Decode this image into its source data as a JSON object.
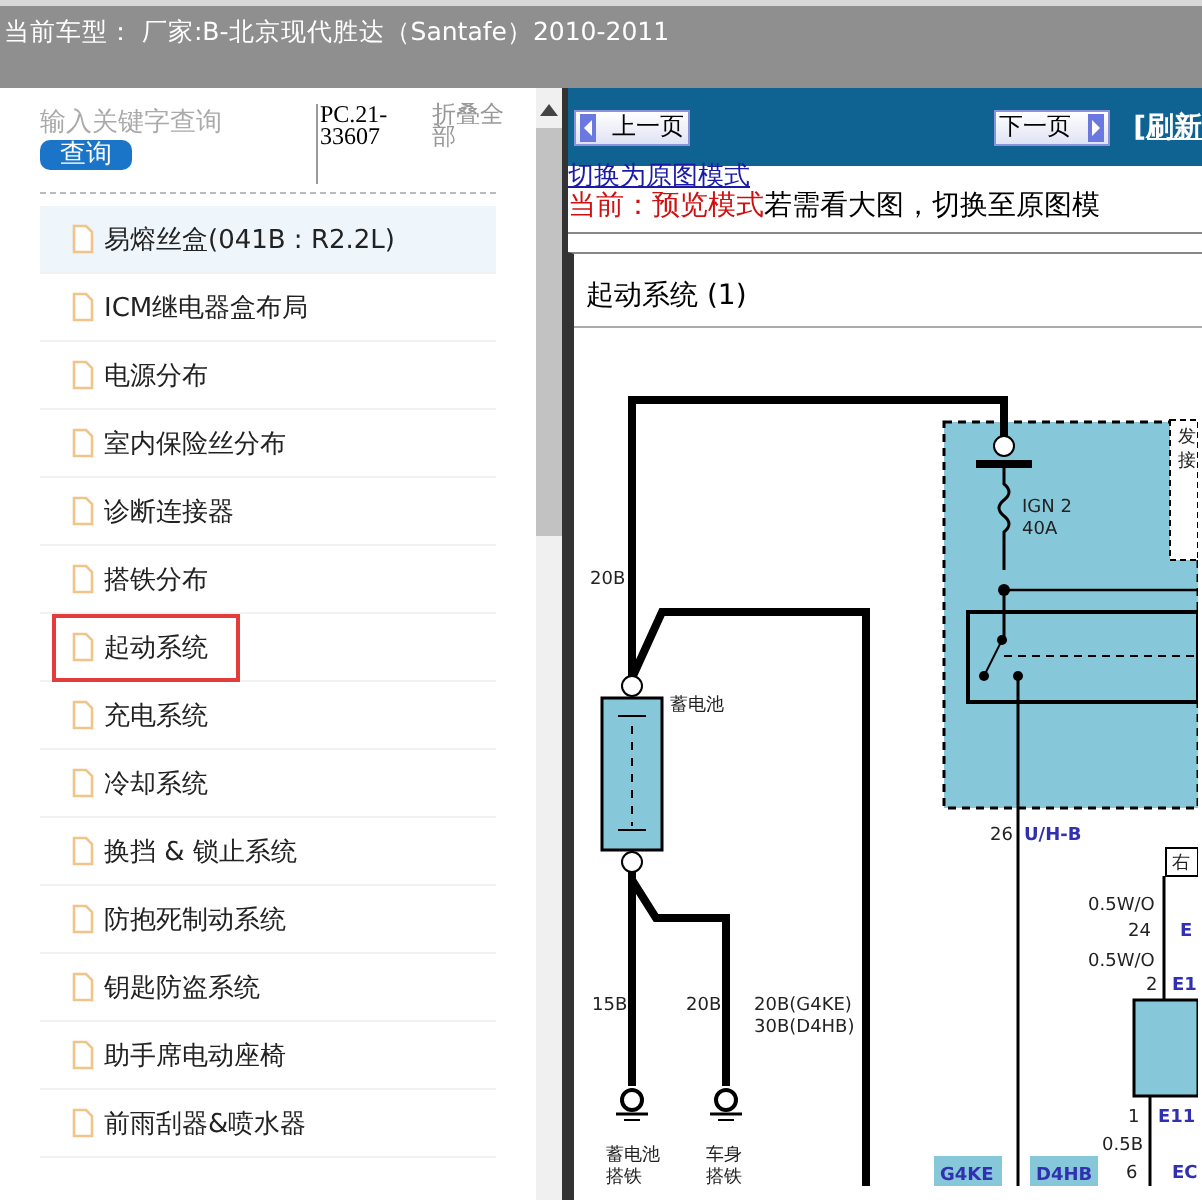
{
  "header": {
    "title": "当前车型： 厂家:B-北京现代胜达（Santafe）2010-2011"
  },
  "sidebar": {
    "search": {
      "placeholder": "输入关键字查询"
    },
    "search_button": "查询",
    "code": "PC.21-33607",
    "collapse_all": "折叠全部",
    "items": [
      {
        "label": "易熔丝盒(041B : R2.2L)",
        "selected": true,
        "highlighted": false
      },
      {
        "label": "ICM继电器盒布局",
        "selected": false,
        "highlighted": false
      },
      {
        "label": "电源分布",
        "selected": false,
        "highlighted": false
      },
      {
        "label": "室内保险丝分布",
        "selected": false,
        "highlighted": false
      },
      {
        "label": "诊断连接器",
        "selected": false,
        "highlighted": false
      },
      {
        "label": "搭铁分布",
        "selected": false,
        "highlighted": false
      },
      {
        "label": "起动系统",
        "selected": false,
        "highlighted": true
      },
      {
        "label": "充电系统",
        "selected": false,
        "highlighted": false
      },
      {
        "label": "冷却系统",
        "selected": false,
        "highlighted": false
      },
      {
        "label": "换挡 & 锁止系统",
        "selected": false,
        "highlighted": false
      },
      {
        "label": "防抱死制动系统",
        "selected": false,
        "highlighted": false
      },
      {
        "label": "钥匙防盗系统",
        "selected": false,
        "highlighted": false
      },
      {
        "label": "助手席电动座椅",
        "selected": false,
        "highlighted": false
      },
      {
        "label": "前雨刮器&喷水器",
        "selected": false,
        "highlighted": false
      }
    ]
  },
  "viewer": {
    "prev_button": "上一页",
    "next_button": "下一页",
    "refresh_link": "[刷新",
    "mode_link": "切换为原图模式",
    "mode_status": "当前：预览模式",
    "mode_hint": "若需看大图，切换至原图模",
    "page_title": "起动系统 (1)",
    "diagram": {
      "labels": [
        "20B",
        "IGN 2",
        "40A",
        "蓄电池",
        "发",
        "接",
        "26",
        "U/H-B",
        "15B",
        "20B",
        "20B(G4KE)",
        "30B(D4HB)",
        "蓄电池",
        "搭铁",
        "车身",
        "搭铁",
        "右",
        "0.5W/O",
        "24",
        "E",
        "0.5W/O",
        "2",
        "E1",
        "1",
        "E11",
        "0.5B",
        "G4KE",
        "D4HB",
        "6",
        "EC"
      ]
    }
  }
}
